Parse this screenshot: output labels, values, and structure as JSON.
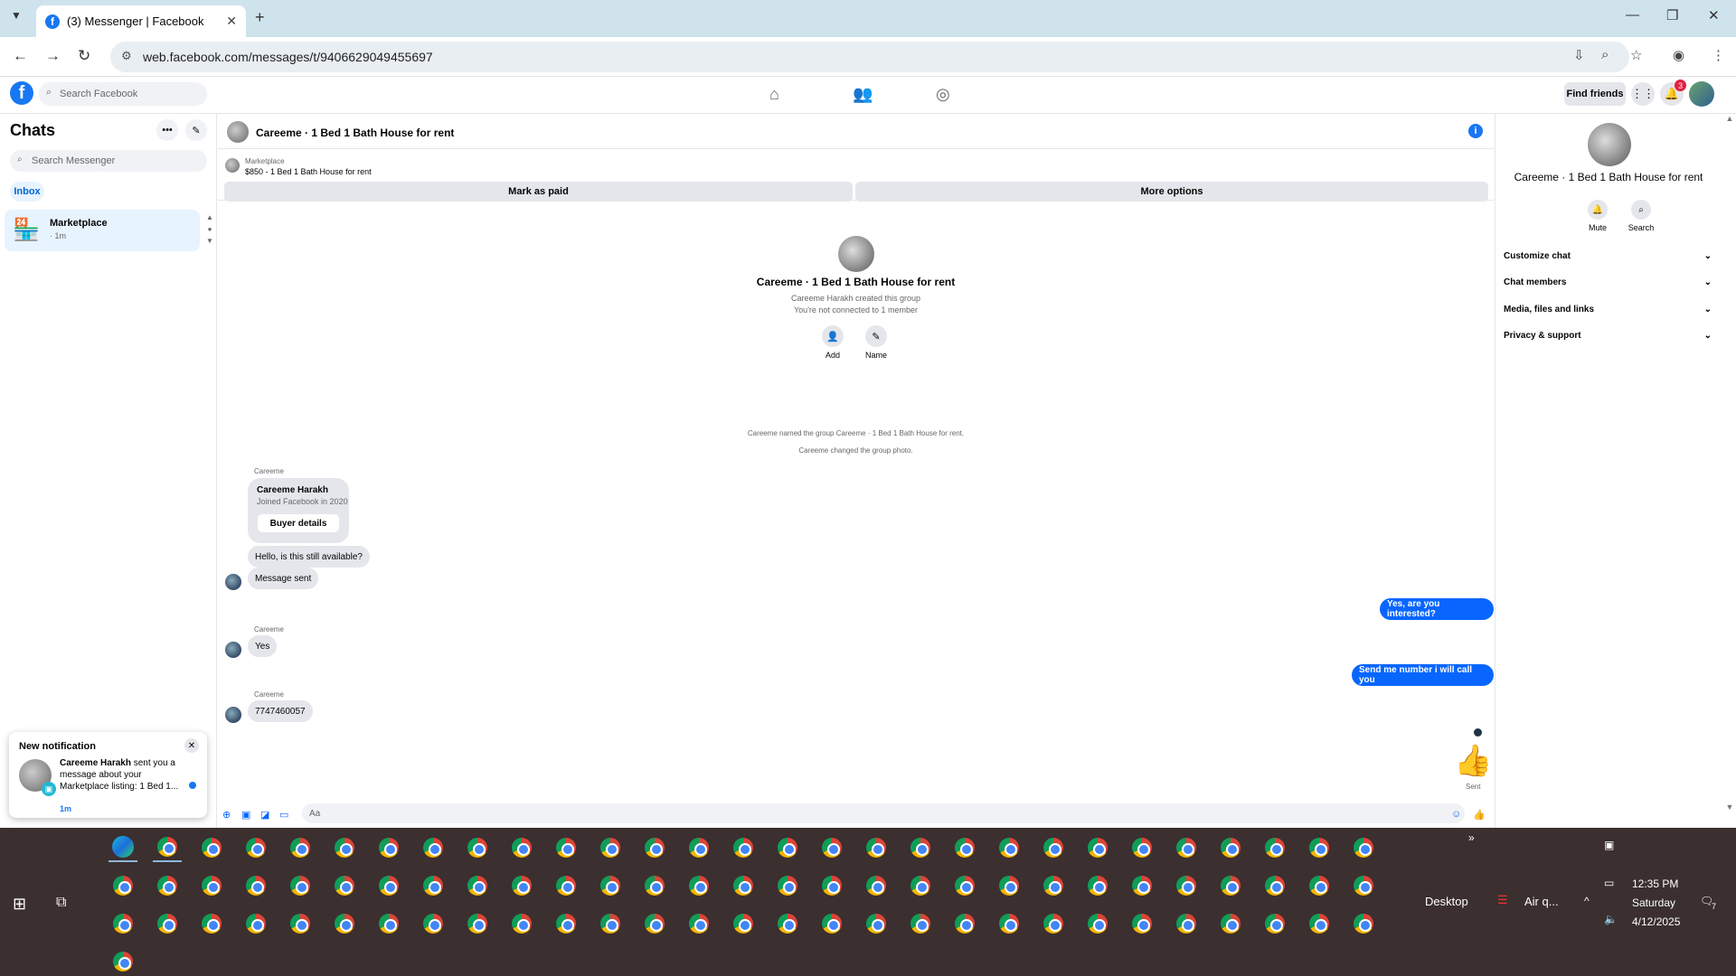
{
  "browser": {
    "tab_title": "(3) Messenger | Facebook",
    "url": "web.facebook.com/messages/t/9406629049455697",
    "new_tab_symbol": "+",
    "close_tab_symbol": "✕"
  },
  "facebook": {
    "logo": "f",
    "search_placeholder": "Search Facebook",
    "find_friends": "Find friends",
    "notifications_count": "3"
  },
  "sidebar": {
    "title": "Chats",
    "search_placeholder": "Search Messenger",
    "filter_chip": "Inbox",
    "chats": [
      {
        "name": "Marketplace",
        "time": "· 1m"
      }
    ]
  },
  "notification": {
    "title": "New notification",
    "sender": "Careeme Harakh",
    "text": " sent you a message about your Marketplace listing: 1 Bed 1...",
    "time": "1m"
  },
  "conversation": {
    "title": "Careeme · 1 Bed 1 Bath House for rent",
    "marketplace_label": "Marketplace",
    "listing": "$850 - 1 Bed 1 Bath House for rent",
    "mark_paid": "Mark as paid",
    "more_options": "More options",
    "group_title": "Careeme · 1 Bed 1 Bath House for rent",
    "created_by": "Careeme Harakh created this group",
    "not_connected": "You're not connected to 1 member",
    "actions": [
      {
        "label": "Add"
      },
      {
        "label": "Name"
      }
    ],
    "system_messages": [
      "Careeme named the group Careeme · 1 Bed 1 Bath House for rent.",
      "Careeme changed the group photo."
    ],
    "sender_name": "Careeme",
    "buyer_card": {
      "name": "Careeme Harakh",
      "joined": "Joined Facebook in 2020",
      "button": "Buyer details"
    },
    "messages": [
      {
        "dir": "in",
        "text": "Hello, is this still available?"
      },
      {
        "dir": "in",
        "text": "Message sent"
      },
      {
        "dir": "out",
        "text": "Yes, are you interested?"
      },
      {
        "dir": "in",
        "text": "Yes"
      },
      {
        "dir": "out",
        "text": "Send me number i will call you"
      },
      {
        "dir": "in",
        "text": "7747460057"
      }
    ],
    "sent_label": "Sent",
    "composer_placeholder": "Aa"
  },
  "details_panel": {
    "title": "Careeme · 1 Bed 1 Bath House for rent",
    "actions": [
      {
        "label": "Mute"
      },
      {
        "label": "Search"
      }
    ],
    "sections": [
      "Customize chat",
      "Chat members",
      "Media, files and links",
      "Privacy & support"
    ]
  },
  "taskbar": {
    "desktop_label": "Desktop",
    "weather": "Air q...",
    "time": "12:35 PM",
    "day": "Saturday",
    "date": "4/12/2025",
    "notif_count": "7",
    "overflow": "»"
  },
  "colors": {
    "brand_blue": "#1877f2",
    "outgoing_bubble": "#0866ff",
    "taskbar_bg": "#3b2f2f"
  }
}
